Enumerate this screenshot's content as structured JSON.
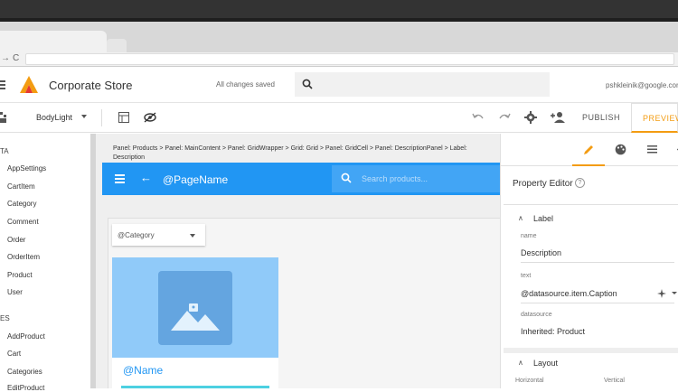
{
  "browser": {
    "nav_forward": "→",
    "nav_reload": "C"
  },
  "app": {
    "title": "Corporate Store",
    "saved_status": "All changes saved",
    "user_email": "pshkleinik@google.com"
  },
  "toolbar": {
    "theme": "BodyLight",
    "publish": "PUBLISH",
    "preview": "PREVIEW"
  },
  "sidebar": {
    "sections": [
      {
        "title": "TA",
        "items": [
          "AppSettings",
          "CartItem",
          "Category",
          "Comment",
          "Order",
          "OrderItem",
          "Product",
          "User"
        ]
      },
      {
        "title": "ES",
        "items": [
          "AddProduct",
          "Cart",
          "Categories",
          "EditProduct"
        ]
      }
    ]
  },
  "canvas": {
    "breadcrumb": "Panel: Products > Panel: MainContent > Panel: GridWrapper > Grid: Grid > Panel: GridCell > Panel: DescriptionPanel > Label: Description",
    "page_name": "@PageName",
    "search_placeholder": "Search products...",
    "category_select": "@Category",
    "product_name": "@Name"
  },
  "property_editor": {
    "title": "Property Editor",
    "label_section": "Label",
    "fields": [
      {
        "label": "name",
        "value": "Description"
      },
      {
        "label": "text",
        "value": "@datasource.item.Caption"
      },
      {
        "label": "datasource",
        "value": "Inherited: Product"
      }
    ],
    "layout_section": "Layout",
    "layout_cols": [
      "Horizontal",
      "Vertical"
    ]
  },
  "colors": {
    "accent": "#f39c12",
    "primary": "#2196f3",
    "image_bg": "#90caf9"
  }
}
